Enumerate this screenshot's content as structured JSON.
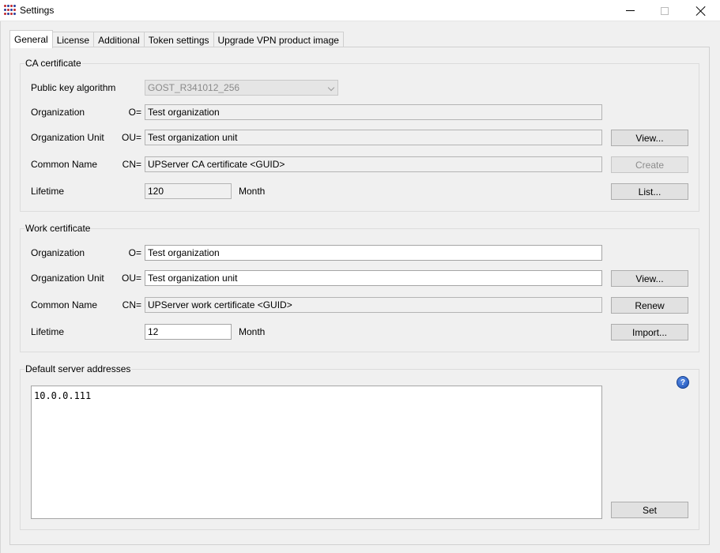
{
  "window": {
    "title": "Settings",
    "icon": "app-dots-icon"
  },
  "tabs": [
    {
      "label": "General",
      "active": true
    },
    {
      "label": "License",
      "active": false
    },
    {
      "label": "Additional",
      "active": false
    },
    {
      "label": "Token settings",
      "active": false
    },
    {
      "label": "Upgrade VPN product image",
      "active": false
    }
  ],
  "ca": {
    "title": "CA certificate",
    "algorithm_label": "Public key algorithm",
    "algorithm_value": "GOST_R341012_256",
    "org_label": "Organization",
    "org_prefix": "O=",
    "org_value": "Test organization",
    "ou_label": "Organization Unit",
    "ou_prefix": "OU=",
    "ou_value": "Test organization unit",
    "cn_label": "Common Name",
    "cn_prefix": "CN=",
    "cn_value": "UPServer CA certificate <GUID>",
    "lifetime_label": "Lifetime",
    "lifetime_value": "120",
    "lifetime_unit": "Month",
    "view_button": "View...",
    "create_button": "Create",
    "list_button": "List..."
  },
  "work": {
    "title": "Work certificate",
    "org_label": "Organization",
    "org_prefix": "O=",
    "org_value": "Test organization",
    "ou_label": "Organization Unit",
    "ou_prefix": "OU=",
    "ou_value": "Test organization unit",
    "cn_label": "Common Name",
    "cn_prefix": "CN=",
    "cn_value": "UPServer work certificate <GUID>",
    "lifetime_label": "Lifetime",
    "lifetime_value": "12",
    "lifetime_unit": "Month",
    "view_button": "View...",
    "renew_button": "Renew",
    "import_button": "Import..."
  },
  "servers": {
    "title": "Default server addresses",
    "addresses": "10.0.0.111",
    "help_icon_label": "?",
    "set_button": "Set"
  }
}
